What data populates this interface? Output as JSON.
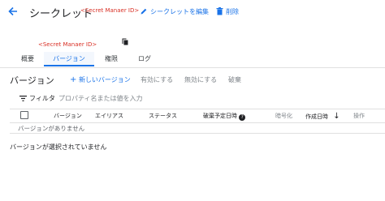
{
  "header": {
    "title": "シークレット",
    "secret_id_annotation": "<Secret Manaer ID>",
    "edit_label": "シークレットを編集",
    "delete_label": "削除"
  },
  "subheader": {
    "secret_id_annotation": "<Secret Manaer ID>"
  },
  "tabs": [
    {
      "label": "概要"
    },
    {
      "label": "バージョン",
      "active": true
    },
    {
      "label": "権限"
    },
    {
      "label": "ログ"
    }
  ],
  "versions": {
    "title": "バージョン",
    "new_version_label": "新しいバージョン",
    "enable_label": "有効にする",
    "disable_label": "無効にする",
    "destroy_label": "破棄"
  },
  "filter": {
    "label": "フィルタ",
    "placeholder": "プロパティ名または値を入力"
  },
  "table": {
    "columns": [
      "バージョン",
      "エイリアス",
      "ステータス",
      "破棄予定日時",
      "暗号化",
      "作成日時",
      "操作"
    ],
    "empty_text": "バージョンがありません"
  },
  "footer": {
    "no_selection_text": "バージョンが選択されていません"
  },
  "colors": {
    "accent": "#1a73e8",
    "annotation": "#d93025",
    "muted": "#80868b"
  }
}
